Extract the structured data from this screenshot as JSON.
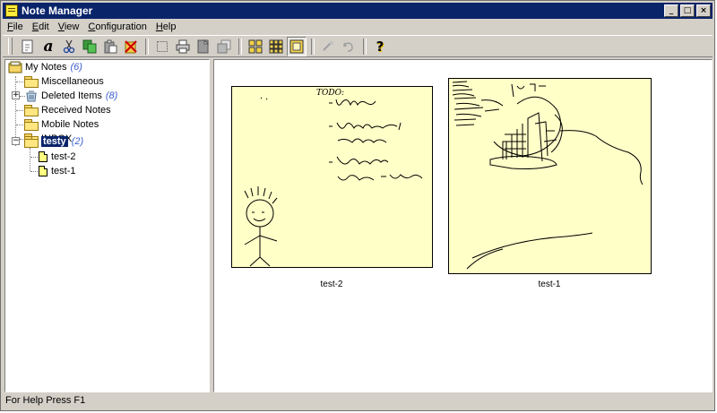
{
  "window": {
    "title": "Note Manager",
    "controls": {
      "minimize": "_",
      "maximize": "□",
      "close": "×"
    }
  },
  "menu": {
    "items": [
      {
        "key": "F",
        "rest": "ile"
      },
      {
        "key": "E",
        "rest": "dit"
      },
      {
        "key": "V",
        "rest": "iew"
      },
      {
        "key": "C",
        "rest": "onfiguration"
      },
      {
        "key": "H",
        "rest": "elp"
      }
    ]
  },
  "toolbar": {
    "buttons": [
      "new-note-icon",
      "font-icon",
      "cut-icon",
      "copy-icon",
      "paste-icon",
      "delete-icon",
      "select-icon",
      "print-icon",
      "properties-icon",
      "send-icon",
      "large-thumbnails-icon",
      "small-thumbnails-icon",
      "single-view-icon",
      "undo-icon",
      "redo-icon",
      "help-icon"
    ],
    "font_glyph": "a",
    "help_glyph": "?"
  },
  "tree": {
    "root": {
      "label": "My Notes",
      "count": "(6)"
    },
    "items": [
      {
        "label": "Miscellaneous",
        "count": ""
      },
      {
        "label": "Deleted Items",
        "count": "(8)"
      },
      {
        "label": "Received Notes",
        "count": ""
      },
      {
        "label": "Mobile Notes",
        "count": ""
      },
      {
        "label": "INBOX",
        "count": ""
      },
      {
        "label": "testy",
        "count": "(2)"
      }
    ],
    "expanders": {
      "deleted": "+",
      "testy": "−"
    },
    "children": [
      "test-2",
      "test-1"
    ]
  },
  "notes": [
    {
      "caption": "test-2",
      "todo_title": "TODO:"
    },
    {
      "caption": "test-1"
    }
  ],
  "status": {
    "text": "For Help Press F1"
  },
  "colors": {
    "title_bar": "#0a246a",
    "note_bg": "#ffffc8",
    "count_text": "#3a5ecf",
    "chrome": "#d4d0c8"
  }
}
